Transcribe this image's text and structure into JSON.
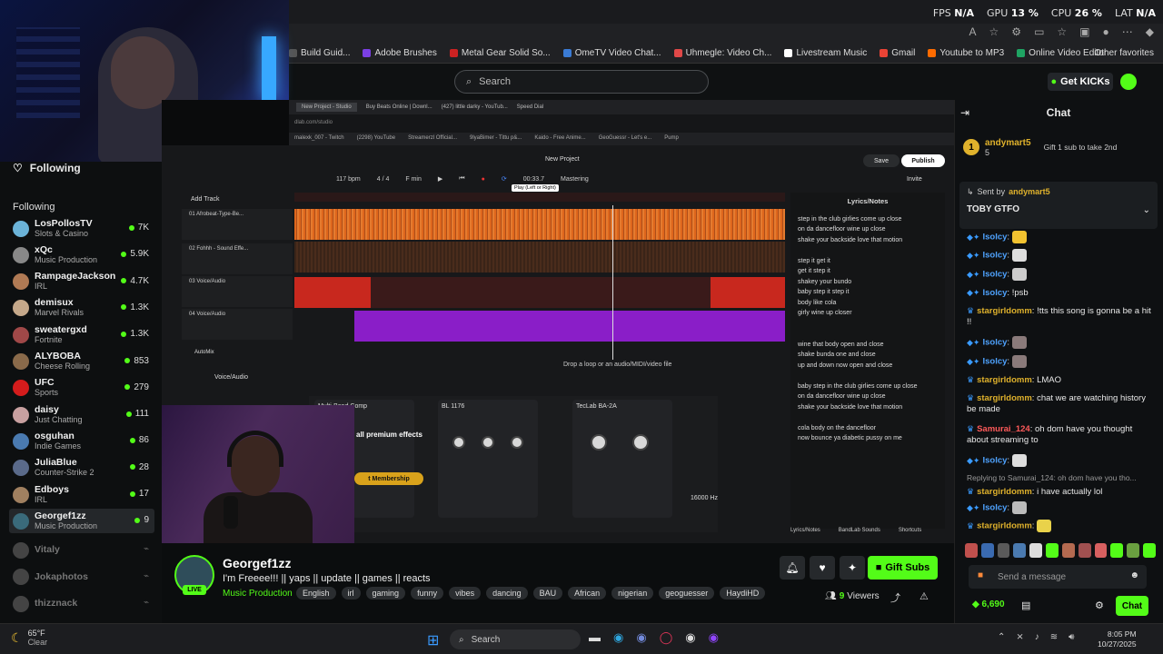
{
  "browser": {
    "perf": {
      "fps_label": "FPS",
      "fps": "N/A",
      "gpu_label": "GPU",
      "gpu": "13 %",
      "cpu_label": "CPU",
      "cpu": "26 %",
      "lat_label": "LAT",
      "lat": "N/A"
    },
    "bookmarks": [
      "Build Guid...",
      "Adobe Brushes",
      "Metal Gear Solid So...",
      "OmeTV Video Chat...",
      "Uhmegle: Video Ch...",
      "Livestream Music",
      "Gmail",
      "Youtube to MP3",
      "Online Video Editor"
    ],
    "bookmark_colors": [
      "#555",
      "#7b3fe4",
      "#cc2222",
      "#3a7bd5",
      "#e04848",
      "#ffffff",
      "#ea4335",
      "#ff6b00",
      "#1fa463"
    ],
    "other_favorites": "Other favorites"
  },
  "header": {
    "search_placeholder": "Search",
    "get_kicks": "Get KICKs"
  },
  "sidebar": {
    "following_title": "Following",
    "following_label": "Following",
    "channels": [
      {
        "name": "LosPollosTV",
        "category": "Slots & Casino",
        "viewers": "7K",
        "color": "#6bb3d8"
      },
      {
        "name": "xQc",
        "category": "Music Production",
        "viewers": "5.9K",
        "color": "#888"
      },
      {
        "name": "RampageJackson",
        "category": "IRL",
        "viewers": "4.7K",
        "color": "#b07a54"
      },
      {
        "name": "demisux",
        "category": "Marvel Rivals",
        "viewers": "1.3K",
        "color": "#c5a88a"
      },
      {
        "name": "sweatergxd",
        "category": "Fortnite",
        "viewers": "1.3K",
        "color": "#a04848"
      },
      {
        "name": "ALYBOBA",
        "category": "Cheese Rolling",
        "viewers": "853",
        "color": "#8a6a4a"
      },
      {
        "name": "UFC",
        "category": "Sports",
        "viewers": "279",
        "color": "#d41c1c"
      },
      {
        "name": "daisy",
        "category": "Just Chatting",
        "viewers": "111",
        "color": "#c8a0a0"
      },
      {
        "name": "osguhan",
        "category": "Indie Games",
        "viewers": "86",
        "color": "#4a7ab0"
      },
      {
        "name": "JuliaBlue",
        "category": "Counter-Strike 2",
        "viewers": "28",
        "color": "#5a6a8a"
      },
      {
        "name": "Edboys",
        "category": "IRL",
        "viewers": "17",
        "color": "#a08060"
      },
      {
        "name": "Georgef1zz",
        "category": "Music Production",
        "viewers": "9",
        "color": "#3a6a7a"
      }
    ],
    "offline": [
      "Vitaly",
      "Jokaphotos",
      "thizznack"
    ]
  },
  "daw": {
    "tabs": [
      "New Project - Studio",
      "Buy Beats Online | Downl...",
      "(427) little darky - YouTub...",
      "Speed Dial"
    ],
    "url": "dlab.com/studio",
    "bookmarks": [
      "malexk_007 - Twitch",
      "(2298) YouTube",
      "Streamerzl Official...",
      "9lyaBimer - Tittu p&...",
      "Kaido - Free Anime...",
      "GeoGuessr - Let's e...",
      "Pump"
    ],
    "title": "New Project",
    "bpm": "117",
    "bpm_unit": "bpm",
    "signature": "4 / 4",
    "key": "F min",
    "time": "00:33.7",
    "mastering": "Mastering",
    "tooltip": "Play (Left or Right)",
    "save": "Save",
    "publish": "Publish",
    "invite": "Invite",
    "add_track": "Add Track",
    "tracks": [
      "01 Afrobeat-Type-Be...",
      "02 Fohhh - Sound Effe...",
      "03 Voice/Audio",
      "04 Voice/Audio"
    ],
    "automix": "AutoMix",
    "voice_audio": "Voice/Audio",
    "drop_hint": "Drop a loop or an audio/MIDI/video file",
    "lyrics_title": "Lyrics/Notes",
    "lyrics": [
      "step in the club girlies come up close",
      "on da dancefloor wine up close",
      "shake your backside love that motion",
      "",
      "step it get it",
      "get it step it",
      "shakey your bundo",
      "baby step it step it",
      "body like cola",
      "girly wine up closer",
      "",
      "",
      "wine that body open and close",
      "shake bunda one and close",
      "up and down now open and close",
      "",
      "baby step in the club girlies come up close",
      "on da dancefloor wine up close",
      "shake your backside love that motion",
      "",
      "cola body on the dancefloor",
      "now bounce ya diabetic pussy on me"
    ],
    "fx": [
      "Multi-Band Comp",
      "BL 1176",
      "TecLab BA-2A"
    ],
    "fx_upsell_line1": "all premium effects",
    "fx_upsell_btn": "t Membership",
    "fx_freq": "16000 Hz",
    "bottom_tabs": [
      "Lyrics/Notes",
      "BandLab Sounds",
      "Shortcuts"
    ]
  },
  "channel": {
    "name": "Georgef1zz",
    "live": "LIVE",
    "title": "I'm Freeee!!! || yaps || update || games || reacts",
    "category": "Music Production",
    "tags": [
      "English",
      "irl",
      "gaming",
      "funny",
      "vibes",
      "dancing",
      "BAU",
      "African",
      "nigerian",
      "geoguesser",
      "HaydiHD"
    ],
    "viewers": "9",
    "viewers_label": "Viewers",
    "gift_subs": "Gift Subs"
  },
  "chat": {
    "title": "Chat",
    "leader": {
      "rank": "1",
      "name": "andymart5",
      "count": "5",
      "sub": "Gift 1 sub to take 2nd"
    },
    "pinned": {
      "sent_by": "Sent by",
      "user": "andymart5",
      "text": "TOBY GTFO"
    },
    "messages": [
      {
        "user": "Isolcy",
        "color": "#4fa3ff",
        "text": "",
        "emote": "#f2c230"
      },
      {
        "user": "Isolcy",
        "color": "#4fa3ff",
        "text": "",
        "emote": "#ddd"
      },
      {
        "user": "Isolcy",
        "color": "#4fa3ff",
        "text": "",
        "emote": "#ccc"
      },
      {
        "user": "Isolcy",
        "color": "#4fa3ff",
        "text": "!psb",
        "emote": ""
      },
      {
        "user": "stargirldomm",
        "color": "#e0b22c",
        "text": "!tts this song is gonna be a hit !!",
        "emote": ""
      },
      {
        "user": "Isolcy",
        "color": "#4fa3ff",
        "text": "",
        "emote": "#8a7a7a"
      },
      {
        "user": "Isolcy",
        "color": "#4fa3ff",
        "text": "",
        "emote": "#8a7a7a"
      },
      {
        "user": "stargirldomm",
        "color": "#e0b22c",
        "text": "LMAO",
        "emote": ""
      },
      {
        "user": "stargirldomm",
        "color": "#e0b22c",
        "text": "chat we are watching history be made",
        "emote": ""
      },
      {
        "user": "Samurai_124",
        "color": "#ff5a5a",
        "text": "oh dom have you thought about streaming to",
        "emote": ""
      },
      {
        "user": "Isolcy",
        "color": "#4fa3ff",
        "text": "",
        "emote": "#ddd"
      },
      {
        "user": "stargirldomm",
        "color": "#e0b22c",
        "text": "i have actually lol",
        "emote": ""
      },
      {
        "user": "Isolcy",
        "color": "#4fa3ff",
        "text": "",
        "emote": "#bbb"
      },
      {
        "user": "stargirldomm",
        "color": "#e0b22c",
        "text": "",
        "emote": "#e9d24a"
      }
    ],
    "reply": "Replying to Samurai_124: oh dom have you tho...",
    "input_placeholder": "Send a message",
    "kicks": "6,690",
    "send": "Chat"
  },
  "taskbar": {
    "temp": "65°F",
    "weather": "Clear",
    "search": "Search",
    "time": "8:05 PM",
    "date": "10/27/2025"
  }
}
